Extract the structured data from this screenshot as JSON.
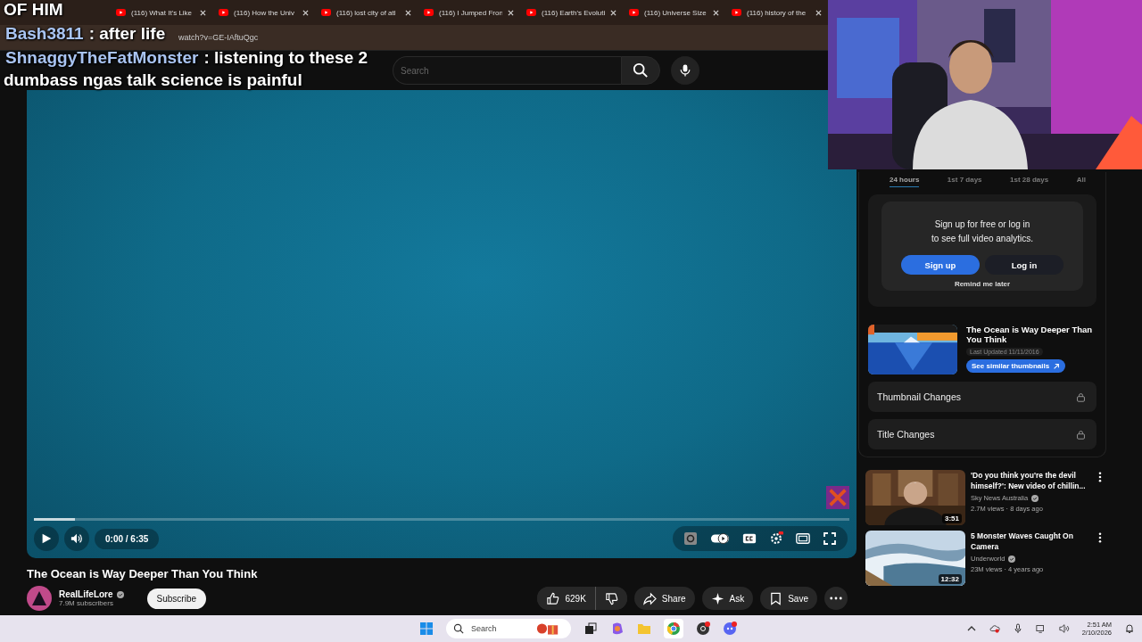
{
  "chat_overlay": [
    {
      "kind": "line",
      "text": "OF HIM"
    },
    {
      "kind": "message",
      "user": "Bash3811",
      "message": ": after life"
    },
    {
      "kind": "message",
      "user": "ShnaggyTheFatMonster",
      "message": ": listening to these 2"
    },
    {
      "kind": "line",
      "text": "dumbass ngas talk science is painful"
    }
  ],
  "tabs": [
    {
      "title": "(116) What It's Like"
    },
    {
      "title": "(116) How the Univ"
    },
    {
      "title": "(116) lost city of atl"
    },
    {
      "title": "(116) I Jumped Fron"
    },
    {
      "title": "(116) Earth's Evoluti"
    },
    {
      "title": "(116) Universe Size"
    },
    {
      "title": "(116) history of the"
    }
  ],
  "address_bar": {
    "url": "watch?v=GE-IAftuQgc"
  },
  "search": {
    "placeholder": "Search"
  },
  "player": {
    "time": "0:00 / 6:35",
    "buffered": {
      "level": 0.05
    }
  },
  "video": {
    "title": "The Ocean is Way Deeper Than You Think",
    "channel": "RealLifeLore",
    "verified": true,
    "subscribers": "7.9M subscribers",
    "subscribe": "Subscribe",
    "likes": "629K",
    "actions": [
      "Share",
      "Ask",
      "Save"
    ]
  },
  "analytics": {
    "ranges": [
      {
        "label": "24 hours",
        "selected": true
      },
      {
        "label": "1st 7 days",
        "selected": false
      },
      {
        "label": "1st 28 days",
        "selected": false
      },
      {
        "label": "All",
        "selected": false
      }
    ],
    "prompt": [
      "Sign up for free or log in",
      "to see full video analytics."
    ],
    "signup": "Sign up",
    "login": "Log in",
    "remind": "Remind me later",
    "thumb_title": "The Ocean is Way Deeper Than You Think",
    "updated": "Last Updated 11/11/2016",
    "similar": "See similar thumbnails",
    "sections": [
      {
        "label": "Thumbnail Changes",
        "locked": true
      },
      {
        "label": "Title Changes",
        "locked": true
      }
    ]
  },
  "recommendations": [
    {
      "title": "'Do you think you're the devil himself?': New video of chillin...",
      "channel": "Sky News Australia",
      "verified": true,
      "meta": "2.7M views · 8 days ago",
      "duration": "3:51",
      "kind": "interior"
    },
    {
      "title": "5 Monster Waves Caught On Camera",
      "channel": "Underworld",
      "verified": true,
      "meta": "23M views · 4 years ago",
      "duration": "12:32",
      "kind": "sea"
    }
  ],
  "taskbar": {
    "search_placeholder": "Search",
    "time": "2:51 AM",
    "date": "2/10/2026"
  }
}
